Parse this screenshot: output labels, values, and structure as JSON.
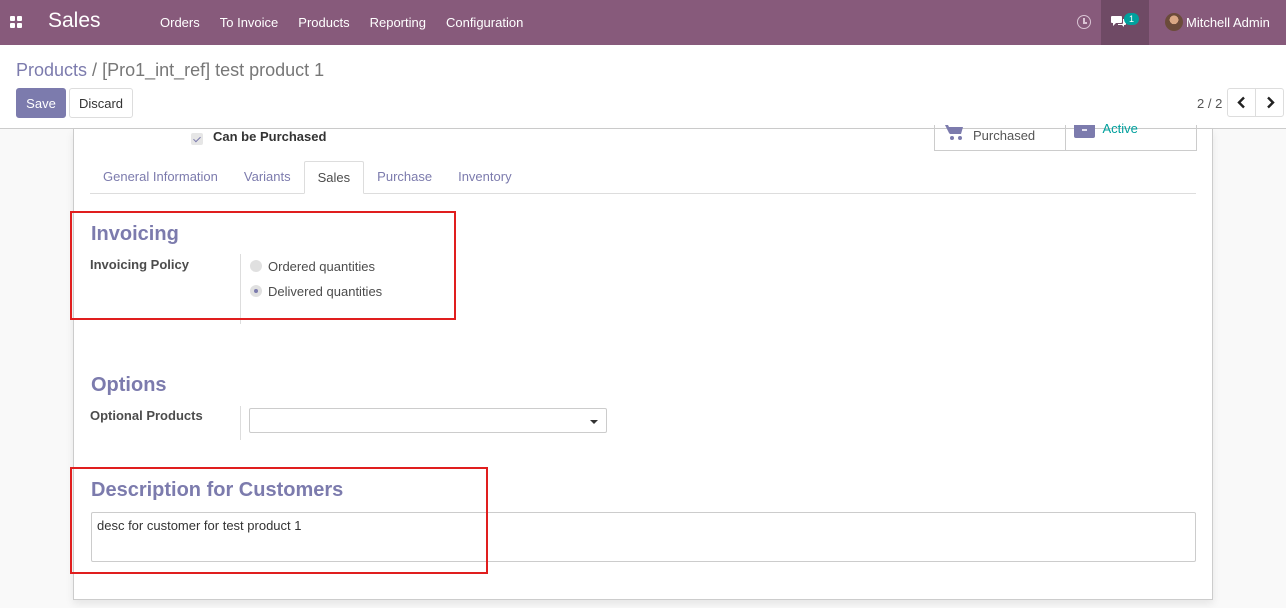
{
  "navbar": {
    "app_title": "Sales",
    "menu": [
      "Orders",
      "To Invoice",
      "Products",
      "Reporting",
      "Configuration"
    ],
    "chat_badge": "1",
    "user_name": "Mitchell Admin",
    "colors": {
      "navbar_bg": "#875a7b",
      "accent": "#7c7bad",
      "teal": "#00a09d"
    }
  },
  "breadcrumb": {
    "parent": "Products",
    "separator": "/",
    "current": "[Pro1_int_ref] test product 1"
  },
  "actions": {
    "save_label": "Save",
    "discard_label": "Discard"
  },
  "pager": {
    "value": "2 / 2"
  },
  "sheet": {
    "can_be_purchased_label": "Can be Purchased",
    "can_be_purchased_checked": true,
    "stat_buttons": {
      "purchased_label": "Purchased",
      "active_label": "Active"
    },
    "tabs": [
      {
        "label": "General Information",
        "active": false
      },
      {
        "label": "Variants",
        "active": false
      },
      {
        "label": "Sales",
        "active": true
      },
      {
        "label": "Purchase",
        "active": false
      },
      {
        "label": "Inventory",
        "active": false
      }
    ],
    "invoicing": {
      "title": "Invoicing",
      "policy_label": "Invoicing Policy",
      "options": [
        {
          "label": "Ordered quantities",
          "checked": false
        },
        {
          "label": "Delivered quantities",
          "checked": true
        }
      ]
    },
    "options_section": {
      "title": "Options",
      "optional_products_label": "Optional Products",
      "optional_products_value": ""
    },
    "description": {
      "title": "Description for Customers",
      "value": "desc for customer for test product 1"
    }
  }
}
